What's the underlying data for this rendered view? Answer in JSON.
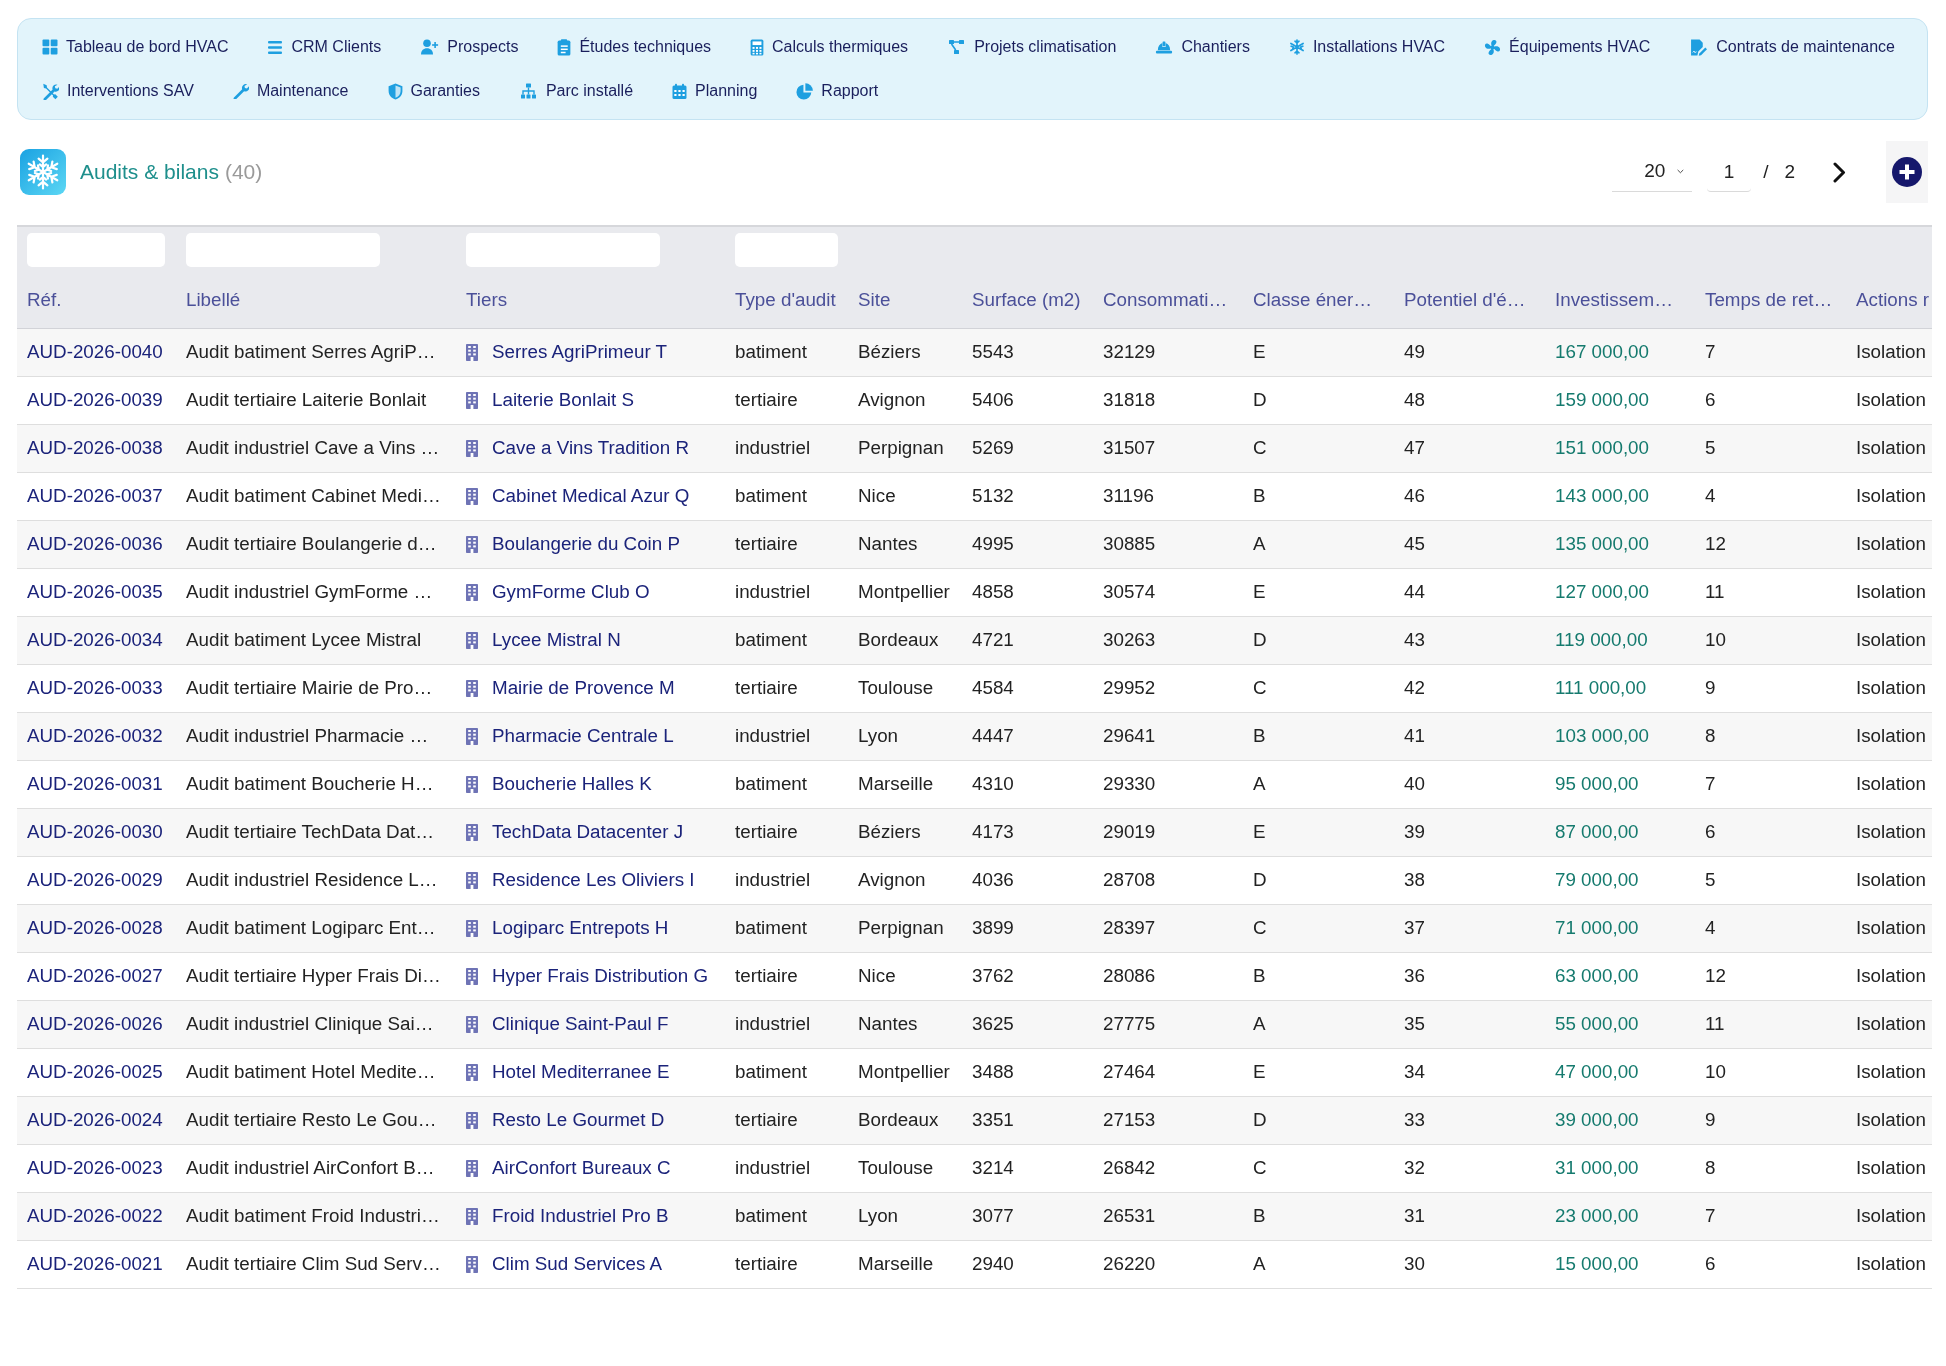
{
  "nav": {
    "items": [
      {
        "label": "Tableau de bord HVAC"
      },
      {
        "label": "CRM Clients"
      },
      {
        "label": "Prospects"
      },
      {
        "label": "Études techniques"
      },
      {
        "label": "Calculs thermiques"
      },
      {
        "label": "Projets climatisation"
      },
      {
        "label": "Chantiers"
      },
      {
        "label": "Installations HVAC"
      },
      {
        "label": "Équipements HVAC"
      },
      {
        "label": "Contrats de maintenance"
      },
      {
        "label": "Interventions SAV"
      },
      {
        "label": "Maintenance"
      },
      {
        "label": "Garanties"
      },
      {
        "label": "Parc installé"
      },
      {
        "label": "Planning"
      },
      {
        "label": "Rapport"
      }
    ]
  },
  "header": {
    "title": "Audits & bilans",
    "count": "(40)"
  },
  "pagination": {
    "page_size": "20",
    "page": "1",
    "separator": "/",
    "total_pages": "2"
  },
  "table": {
    "columns": [
      {
        "label": "Réf.",
        "kind": "ref",
        "filter": true
      },
      {
        "label": "Libellé",
        "kind": "text",
        "filter": true
      },
      {
        "label": "Tiers",
        "kind": "tiers",
        "filter": true
      },
      {
        "label": "Type d'audit",
        "kind": "text",
        "filter": true
      },
      {
        "label": "Site",
        "kind": "text",
        "filter": false
      },
      {
        "label": "Surface (m2)",
        "kind": "text",
        "filter": false
      },
      {
        "label": "Consommati…",
        "kind": "text",
        "filter": false
      },
      {
        "label": "Classe éner…",
        "kind": "text",
        "filter": false
      },
      {
        "label": "Potentiel d'é…",
        "kind": "text",
        "filter": false
      },
      {
        "label": "Investissem…",
        "kind": "amount",
        "filter": false
      },
      {
        "label": "Temps de ret…",
        "kind": "text",
        "filter": false
      },
      {
        "label": "Actions r",
        "kind": "text",
        "filter": false
      }
    ],
    "rows": [
      [
        "AUD-2026-0040",
        "Audit batiment Serres AgriP…",
        "Serres AgriPrimeur T",
        "batiment",
        "Béziers",
        "5543",
        "32129",
        "E",
        "49",
        "167 000,00",
        "7",
        "Isolation"
      ],
      [
        "AUD-2026-0039",
        "Audit tertiaire Laiterie Bonlait",
        "Laiterie Bonlait S",
        "tertiaire",
        "Avignon",
        "5406",
        "31818",
        "D",
        "48",
        "159 000,00",
        "6",
        "Isolation"
      ],
      [
        "AUD-2026-0038",
        "Audit industriel Cave a Vins …",
        "Cave a Vins Tradition R",
        "industriel",
        "Perpignan",
        "5269",
        "31507",
        "C",
        "47",
        "151 000,00",
        "5",
        "Isolation"
      ],
      [
        "AUD-2026-0037",
        "Audit batiment Cabinet Medi…",
        "Cabinet Medical Azur Q",
        "batiment",
        "Nice",
        "5132",
        "31196",
        "B",
        "46",
        "143 000,00",
        "4",
        "Isolation"
      ],
      [
        "AUD-2026-0036",
        "Audit tertiaire Boulangerie d…",
        "Boulangerie du Coin P",
        "tertiaire",
        "Nantes",
        "4995",
        "30885",
        "A",
        "45",
        "135 000,00",
        "12",
        "Isolation"
      ],
      [
        "AUD-2026-0035",
        "Audit industriel GymForme …",
        "GymForme Club O",
        "industriel",
        "Montpellier",
        "4858",
        "30574",
        "E",
        "44",
        "127 000,00",
        "11",
        "Isolation"
      ],
      [
        "AUD-2026-0034",
        "Audit batiment Lycee Mistral",
        "Lycee Mistral N",
        "batiment",
        "Bordeaux",
        "4721",
        "30263",
        "D",
        "43",
        "119 000,00",
        "10",
        "Isolation"
      ],
      [
        "AUD-2026-0033",
        "Audit tertiaire Mairie de Pro…",
        "Mairie de Provence M",
        "tertiaire",
        "Toulouse",
        "4584",
        "29952",
        "C",
        "42",
        "111 000,00",
        "9",
        "Isolation"
      ],
      [
        "AUD-2026-0032",
        "Audit industriel Pharmacie …",
        "Pharmacie Centrale L",
        "industriel",
        "Lyon",
        "4447",
        "29641",
        "B",
        "41",
        "103 000,00",
        "8",
        "Isolation"
      ],
      [
        "AUD-2026-0031",
        "Audit batiment Boucherie H…",
        "Boucherie Halles K",
        "batiment",
        "Marseille",
        "4310",
        "29330",
        "A",
        "40",
        "95 000,00",
        "7",
        "Isolation"
      ],
      [
        "AUD-2026-0030",
        "Audit tertiaire TechData Dat…",
        "TechData Datacenter J",
        "tertiaire",
        "Béziers",
        "4173",
        "29019",
        "E",
        "39",
        "87 000,00",
        "6",
        "Isolation"
      ],
      [
        "AUD-2026-0029",
        "Audit industriel Residence L…",
        "Residence Les Oliviers I",
        "industriel",
        "Avignon",
        "4036",
        "28708",
        "D",
        "38",
        "79 000,00",
        "5",
        "Isolation"
      ],
      [
        "AUD-2026-0028",
        "Audit batiment Logiparc Ent…",
        "Logiparc Entrepots H",
        "batiment",
        "Perpignan",
        "3899",
        "28397",
        "C",
        "37",
        "71 000,00",
        "4",
        "Isolation"
      ],
      [
        "AUD-2026-0027",
        "Audit tertiaire Hyper Frais Di…",
        "Hyper Frais Distribution G",
        "tertiaire",
        "Nice",
        "3762",
        "28086",
        "B",
        "36",
        "63 000,00",
        "12",
        "Isolation"
      ],
      [
        "AUD-2026-0026",
        "Audit industriel Clinique Sai…",
        "Clinique Saint-Paul F",
        "industriel",
        "Nantes",
        "3625",
        "27775",
        "A",
        "35",
        "55 000,00",
        "11",
        "Isolation"
      ],
      [
        "AUD-2026-0025",
        "Audit batiment Hotel Medite…",
        "Hotel Mediterranee E",
        "batiment",
        "Montpellier",
        "3488",
        "27464",
        "E",
        "34",
        "47 000,00",
        "10",
        "Isolation"
      ],
      [
        "AUD-2026-0024",
        "Audit tertiaire Resto Le Gou…",
        "Resto Le Gourmet D",
        "tertiaire",
        "Bordeaux",
        "3351",
        "27153",
        "D",
        "33",
        "39 000,00",
        "9",
        "Isolation"
      ],
      [
        "AUD-2026-0023",
        "Audit industriel AirConfort B…",
        "AirConfort Bureaux C",
        "industriel",
        "Toulouse",
        "3214",
        "26842",
        "C",
        "32",
        "31 000,00",
        "8",
        "Isolation"
      ],
      [
        "AUD-2026-0022",
        "Audit batiment Froid Industri…",
        "Froid Industriel Pro B",
        "batiment",
        "Lyon",
        "3077",
        "26531",
        "B",
        "31",
        "23 000,00",
        "7",
        "Isolation"
      ],
      [
        "AUD-2026-0021",
        "Audit tertiaire Clim Sud Serv…",
        "Clim Sud Services A",
        "tertiaire",
        "Marseille",
        "2940",
        "26220",
        "A",
        "30",
        "15 000,00",
        "6",
        "Isolation"
      ]
    ]
  }
}
